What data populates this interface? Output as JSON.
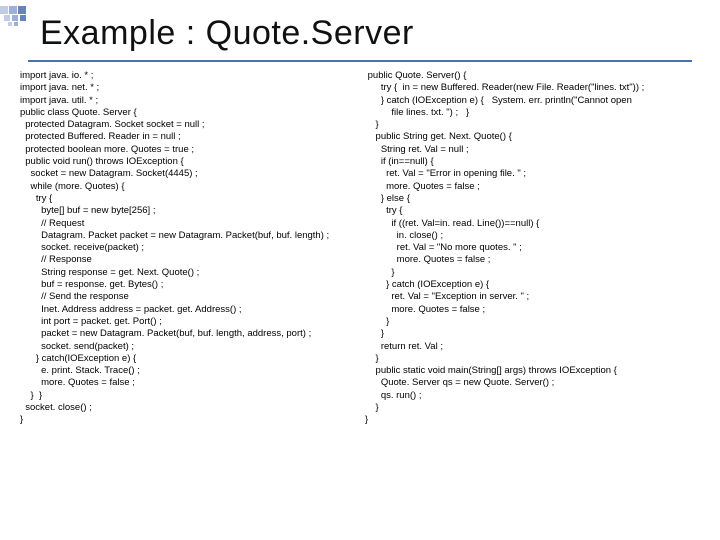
{
  "title": "Example : Quote.Server",
  "codeLeft": "import java. io. * ;\nimport java. net. * ;\nimport java. util. * ;\npublic class Quote. Server {\n  protected Datagram. Socket socket = null ;\n  protected Buffered. Reader in = null ;\n  protected boolean more. Quotes = true ;\n  public void run() throws IOException {\n    socket = new Datagram. Socket(4445) ;\n    while (more. Quotes) {\n      try {\n        byte[] buf = new byte[256] ;\n        // Request\n        Datagram. Packet packet = new Datagram. Packet(buf, buf. length) ;\n        socket. receive(packet) ;\n        // Response\n        String response = get. Next. Quote() ;\n        buf = response. get. Bytes() ;\n        // Send the response\n        Inet. Address address = packet. get. Address() ;\n        int port = packet. get. Port() ;\n        packet = new Datagram. Packet(buf, buf. length, address, port) ;\n        socket. send(packet) ;\n      } catch(IOException e) {\n        e. print. Stack. Trace() ;\n        more. Quotes = false ;\n    }  }\n  socket. close() ;\n}",
  "codeRight": " public Quote. Server() {\n      try {  in = new Buffered. Reader(new File. Reader(\"lines. txt\")) ;\n      } catch (IOException e) {   System. err. println(\"Cannot open\n          file lines. txt. \") ;   }\n    }\n    public String get. Next. Quote() {\n      String ret. Val = null ;\n      if (in==null) {\n        ret. Val = \"Error in opening file. \" ;\n        more. Quotes = false ;\n      } else {\n        try {\n          if ((ret. Val=in. read. Line())==null) {\n            in. close() ;\n            ret. Val = \"No more quotes. \" ;\n            more. Quotes = false ;\n          }\n        } catch (IOException e) {\n          ret. Val = \"Exception in server. \" ;\n          more. Quotes = false ;\n        }\n      }\n      return ret. Val ;\n    }\n    public static void main(String[] args) throws IOException {\n      Quote. Server qs = new Quote. Server() ;\n      qs. run() ;\n    }\n}"
}
